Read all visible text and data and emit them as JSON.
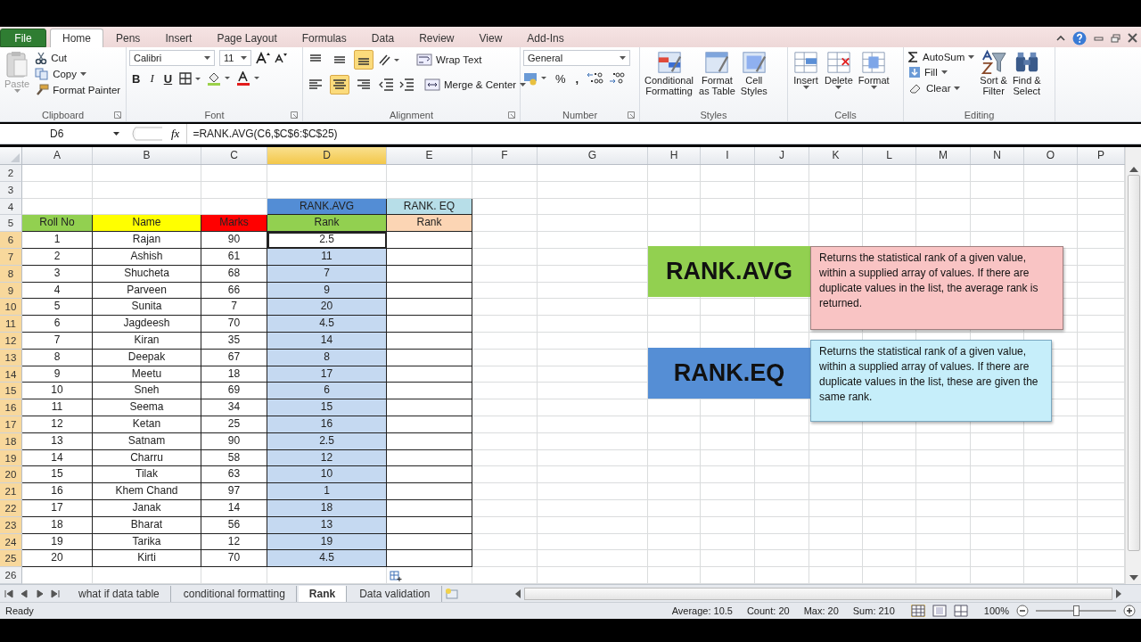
{
  "ribbon": {
    "tabs": [
      {
        "label": "File",
        "kind": "file",
        "selected": false
      },
      {
        "label": "Home",
        "kind": "tab",
        "selected": true
      },
      {
        "label": "Pens",
        "kind": "tab",
        "selected": false
      },
      {
        "label": "Insert",
        "kind": "tab",
        "selected": false
      },
      {
        "label": "Page Layout",
        "kind": "tab",
        "selected": false
      },
      {
        "label": "Formulas",
        "kind": "tab",
        "selected": false
      },
      {
        "label": "Data",
        "kind": "tab",
        "selected": false
      },
      {
        "label": "Review",
        "kind": "tab",
        "selected": false
      },
      {
        "label": "View",
        "kind": "tab",
        "selected": false
      },
      {
        "label": "Add-Ins",
        "kind": "tab",
        "selected": false
      }
    ],
    "clipboard": {
      "label": "Clipboard",
      "paste": "Paste",
      "paste_disabled": true,
      "cut": "Cut",
      "copy": "Copy",
      "format_painter": "Format Painter"
    },
    "font": {
      "label": "Font",
      "font_name": "Calibri",
      "font_size": "11",
      "bold": "B",
      "italic": "I",
      "underline": "U"
    },
    "alignment": {
      "label": "Alignment",
      "bottom_align_on": true,
      "center_on": true,
      "wrap_text": "Wrap Text",
      "merge_center": "Merge & Center"
    },
    "number": {
      "label": "Number",
      "format": "General",
      "percent": "%",
      "comma": ","
    },
    "styles": {
      "label": "Styles",
      "buttons": [
        {
          "lines": [
            "Conditional",
            "Formatting"
          ]
        },
        {
          "lines": [
            "Format",
            "as Table"
          ]
        },
        {
          "lines": [
            "Cell",
            "Styles"
          ]
        }
      ]
    },
    "cells": {
      "label": "Cells",
      "buttons": [
        "Insert",
        "Delete",
        "Format"
      ]
    },
    "editing": {
      "label": "Editing",
      "autosum": "AutoSum",
      "fill": "Fill",
      "clear": "Clear",
      "buttons": [
        {
          "lines": [
            "Sort &",
            "Filter"
          ]
        },
        {
          "lines": [
            "Find &",
            "Select"
          ]
        }
      ]
    }
  },
  "formula_bar": {
    "name_box": "D6",
    "fx": "fx",
    "formula": "=RANK.AVG(C6,$C$6:$C$25)"
  },
  "sheet": {
    "columns": [
      {
        "label": "A",
        "selected": false
      },
      {
        "label": "B",
        "selected": false
      },
      {
        "label": "C",
        "selected": false
      },
      {
        "label": "D",
        "selected": true
      },
      {
        "label": "E",
        "selected": false
      },
      {
        "label": "F",
        "selected": false
      },
      {
        "label": "G",
        "selected": false
      },
      {
        "label": "H",
        "selected": false
      },
      {
        "label": "I",
        "selected": false
      },
      {
        "label": "J",
        "selected": false
      },
      {
        "label": "K",
        "selected": false
      },
      {
        "label": "L",
        "selected": false
      },
      {
        "label": "M",
        "selected": false
      },
      {
        "label": "N",
        "selected": false
      },
      {
        "label": "O",
        "selected": false
      },
      {
        "label": "P",
        "selected": false
      }
    ],
    "rows": [
      {
        "label": "2",
        "selected": false
      },
      {
        "label": "3",
        "selected": false
      },
      {
        "label": "4",
        "selected": false
      },
      {
        "label": "5",
        "selected": false
      },
      {
        "label": "6",
        "selected": true
      },
      {
        "label": "7",
        "selected": true
      },
      {
        "label": "8",
        "selected": true
      },
      {
        "label": "9",
        "selected": true
      },
      {
        "label": "10",
        "selected": true
      },
      {
        "label": "11",
        "selected": true
      },
      {
        "label": "12",
        "selected": true
      },
      {
        "label": "13",
        "selected": true
      },
      {
        "label": "14",
        "selected": true
      },
      {
        "label": "15",
        "selected": true
      },
      {
        "label": "16",
        "selected": true
      },
      {
        "label": "17",
        "selected": true
      },
      {
        "label": "18",
        "selected": true
      },
      {
        "label": "19",
        "selected": true
      },
      {
        "label": "20",
        "selected": true
      },
      {
        "label": "21",
        "selected": true
      },
      {
        "label": "22",
        "selected": true
      },
      {
        "label": "23",
        "selected": true
      },
      {
        "label": "24",
        "selected": true
      },
      {
        "label": "25",
        "selected": true
      },
      {
        "label": "26",
        "selected": false
      }
    ]
  },
  "table": {
    "group_headers": [
      {
        "text": "RANK.AVG",
        "color": "#538dd5"
      },
      {
        "text": "RANK. EQ",
        "color": "#b7dee8"
      }
    ],
    "columns": [
      {
        "text": "Roll No",
        "color": "#92d050"
      },
      {
        "text": "Name",
        "color": "#ffff00"
      },
      {
        "text": "Marks",
        "color": "#ff0000"
      },
      {
        "text": "Rank",
        "color": "#92d050"
      },
      {
        "text": "Rank",
        "color": "#fcd5b4"
      }
    ],
    "rows": [
      {
        "roll": "1",
        "name": "Rajan",
        "marks": "90",
        "rank_avg": "2.5",
        "selected": true
      },
      {
        "roll": "2",
        "name": "Ashish",
        "marks": "61",
        "rank_avg": "11",
        "selected": true
      },
      {
        "roll": "3",
        "name": "Shucheta",
        "marks": "68",
        "rank_avg": "7",
        "selected": true
      },
      {
        "roll": "4",
        "name": "Parveen",
        "marks": "66",
        "rank_avg": "9",
        "selected": true
      },
      {
        "roll": "5",
        "name": "Sunita",
        "marks": "7",
        "rank_avg": "20",
        "selected": true
      },
      {
        "roll": "6",
        "name": "Jagdeesh",
        "marks": "70",
        "rank_avg": "4.5",
        "selected": true
      },
      {
        "roll": "7",
        "name": "Kiran",
        "marks": "35",
        "rank_avg": "14",
        "selected": true
      },
      {
        "roll": "8",
        "name": "Deepak",
        "marks": "67",
        "rank_avg": "8",
        "selected": true
      },
      {
        "roll": "9",
        "name": "Meetu",
        "marks": "18",
        "rank_avg": "17",
        "selected": true
      },
      {
        "roll": "10",
        "name": "Sneh",
        "marks": "69",
        "rank_avg": "6",
        "selected": true
      },
      {
        "roll": "11",
        "name": "Seema",
        "marks": "34",
        "rank_avg": "15",
        "selected": true
      },
      {
        "roll": "12",
        "name": "Ketan",
        "marks": "25",
        "rank_avg": "16",
        "selected": true
      },
      {
        "roll": "13",
        "name": "Satnam",
        "marks": "90",
        "rank_avg": "2.5",
        "selected": true
      },
      {
        "roll": "14",
        "name": "Charru",
        "marks": "58",
        "rank_avg": "12",
        "selected": true
      },
      {
        "roll": "15",
        "name": "Tilak",
        "marks": "63",
        "rank_avg": "10",
        "selected": true
      },
      {
        "roll": "16",
        "name": "Khem Chand",
        "marks": "97",
        "rank_avg": "1",
        "selected": true
      },
      {
        "roll": "17",
        "name": "Janak",
        "marks": "14",
        "rank_avg": "18",
        "selected": true
      },
      {
        "roll": "18",
        "name": "Bharat",
        "marks": "56",
        "rank_avg": "13",
        "selected": true
      },
      {
        "roll": "19",
        "name": "Tarika",
        "marks": "12",
        "rank_avg": "19",
        "selected": true
      },
      {
        "roll": "20",
        "name": "Kirti",
        "marks": "70",
        "rank_avg": "4.5",
        "selected": true
      }
    ]
  },
  "callouts": [
    {
      "title": {
        "text": "RANK.AVG",
        "color": "#92d050"
      },
      "note": {
        "text": "Returns the statistical rank of a  given value, within a supplied array of values. If there are duplicate values in the list, the average rank is returned.",
        "color": "#f9c4c4"
      }
    },
    {
      "title": {
        "text": "RANK.EQ",
        "color": "#558ed5"
      },
      "note": {
        "text": "Returns the statistical rank of a  given value, within a supplied array of values. If there are duplicate values in the list, these are given the same rank.",
        "color": "#c6eefa"
      }
    }
  ],
  "sheet_tabs": [
    {
      "label": "what if data table",
      "selected": false
    },
    {
      "label": "conditional formatting",
      "selected": false
    },
    {
      "label": "Rank",
      "selected": true
    },
    {
      "label": "Data validation",
      "selected": false
    }
  ],
  "status_bar": {
    "status": "Ready",
    "stats": [
      "Average: 10.5",
      "Count: 20",
      "Max: 20",
      "Sum: 210"
    ],
    "zoom": "100%",
    "zoom_slider": {
      "level": 0.5
    }
  }
}
